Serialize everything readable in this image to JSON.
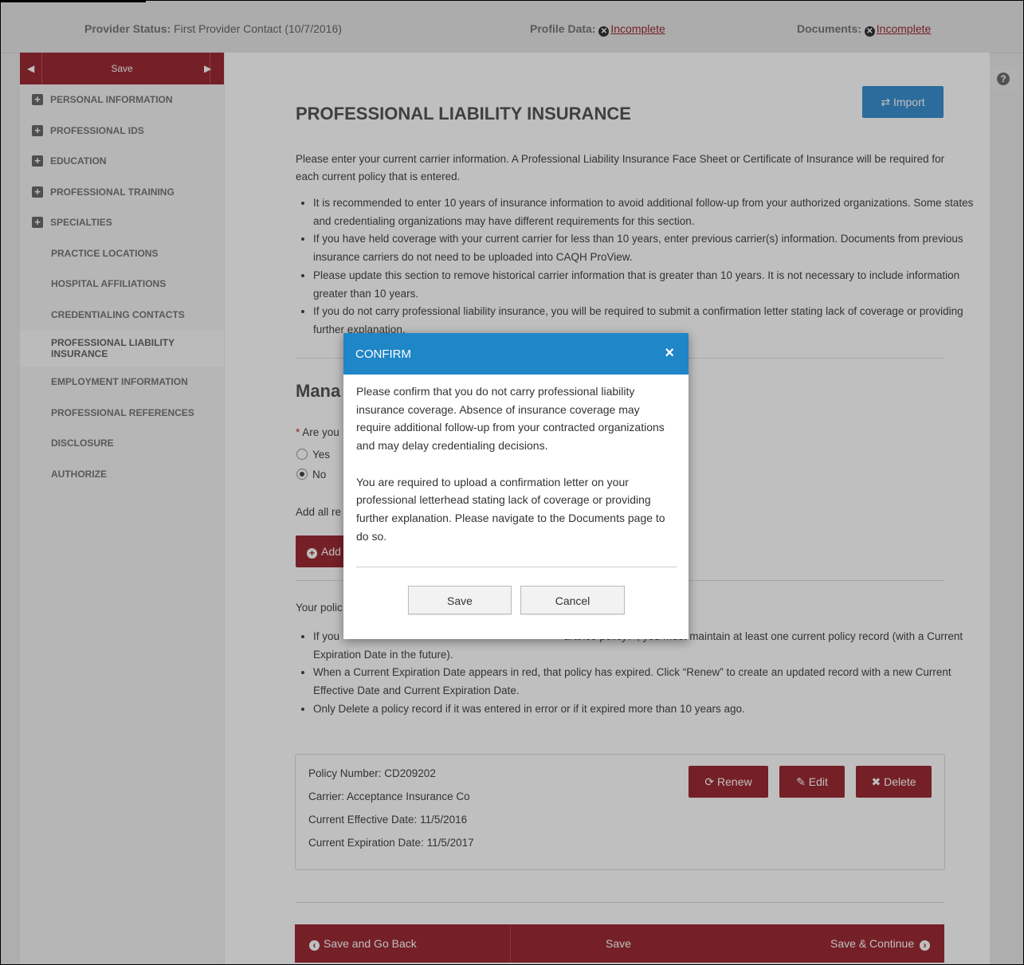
{
  "topbar": {
    "provider_status_label": "Provider Status:",
    "provider_status_value": "First Provider Contact (10/7/2016)",
    "profile_label": "Profile Data:",
    "profile_value": "Incomplete",
    "documents_label": "Documents:",
    "documents_value": "Incomplete"
  },
  "sidebar": {
    "save_label": "Save",
    "items": [
      {
        "label": "PERSONAL INFORMATION",
        "expandable": true
      },
      {
        "label": "PROFESSIONAL IDS",
        "expandable": true
      },
      {
        "label": "EDUCATION",
        "expandable": true
      },
      {
        "label": "PROFESSIONAL TRAINING",
        "expandable": true
      },
      {
        "label": "SPECIALTIES",
        "expandable": true
      },
      {
        "label": "PRACTICE LOCATIONS",
        "expandable": false
      },
      {
        "label": "HOSPITAL AFFILIATIONS",
        "expandable": false
      },
      {
        "label": "CREDENTIALING CONTACTS",
        "expandable": false
      },
      {
        "label": "PROFESSIONAL LIABILITY INSURANCE",
        "expandable": false,
        "active": true
      },
      {
        "label": "EMPLOYMENT INFORMATION",
        "expandable": false
      },
      {
        "label": "PROFESSIONAL REFERENCES",
        "expandable": false
      },
      {
        "label": "DISCLOSURE",
        "expandable": false
      },
      {
        "label": "AUTHORIZE",
        "expandable": false
      }
    ]
  },
  "main": {
    "import_label": "Import",
    "title": "PROFESSIONAL LIABILITY INSURANCE",
    "intro": "Please enter your current carrier information. A Professional Liability Insurance Face Sheet or Certificate of Insurance will be required for each current policy that is entered.",
    "bullets": [
      "It is recommended to enter 10 years of insurance information to avoid additional follow-up from your authorized organizations. Some states and credentialing organizations may have different requirements for this section.",
      "If you have held coverage with your current carrier for less than 10 years, enter previous carrier(s) information. Documents from previous insurance carriers do not need to be uploaded into CAQH ProView.",
      "Please update this section to remove historical carrier information that is greater than 10 years. It is not necessary to include information greater than 10 years.",
      "If you do not carry professional liability insurance, you will be required to submit a confirmation letter stating lack of coverage or providing further explanation."
    ],
    "manage_heading": "Mana",
    "question": "Are you",
    "radio_yes": "Yes",
    "radio_no": "No",
    "add_all_text": "Add all re",
    "add_button": "Add",
    "policy_intro": "Your polic",
    "policy_bullets": [
      "If you                                                                           urance policy?\", you must maintain at least one current policy record (with a Current Expiration Date in the future).",
      "When a Current Expiration Date appears in red, that policy has expired. Click “Renew” to create an updated record with a new Current Effective Date and Current Expiration Date.",
      "Only Delete a policy record if it was entered in error or if it expired more than 10 years ago."
    ],
    "policy": {
      "number": "Policy Number: CD209202",
      "carrier": "Carrier: Acceptance Insurance Co",
      "effective": "Current Effective Date: 11/5/2016",
      "expiration": "Current Expiration Date: 11/5/2017",
      "renew": "Renew",
      "edit": "Edit",
      "delete": "Delete"
    },
    "footer": {
      "back": "Save and Go Back",
      "save": "Save",
      "continue": "Save & Continue"
    }
  },
  "modal": {
    "title": "CONFIRM",
    "para1": "Please confirm that you do not carry professional liability insurance coverage. Absence of insurance coverage may require additional follow-up from your contracted organizations and may delay credentialing decisions.",
    "para2": "You are required to upload a confirmation letter on your professional letterhead stating lack of coverage or providing further explanation. Please navigate to the Documents page to do so.",
    "save": "Save",
    "cancel": "Cancel"
  },
  "colors": {
    "accent": "#9d2b35",
    "modal_header": "#1f86c7",
    "import_button": "#3a90d0"
  }
}
